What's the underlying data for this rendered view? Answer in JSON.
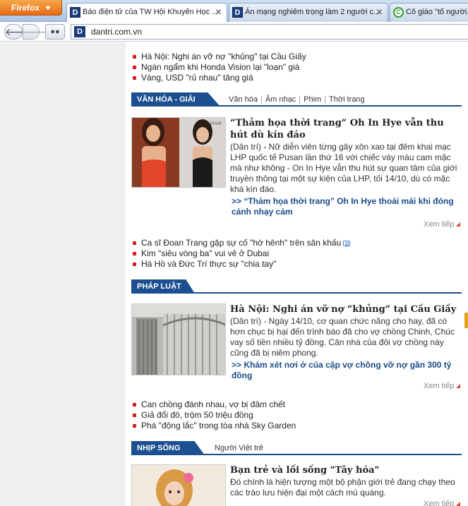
{
  "browser": {
    "menu_label": "Firefox",
    "tabs": [
      {
        "title": "Báo điện tử của TW Hội Khuyến Học ...",
        "favicon": "D",
        "active": true
      },
      {
        "title": "Án mạng nghiêm trọng làm 2 người c...",
        "favicon": "D",
        "active": false
      },
      {
        "title": "Cô giáo \"tố người...",
        "favicon": "C",
        "active": false
      }
    ],
    "url": "dantri.com.vn",
    "url_favicon": "D"
  },
  "top_list": [
    {
      "text": "Hà Nội: Nghi án vỡ nợ \"khủng\" tại Cầu Giấy"
    },
    {
      "text": "Ngán ngẩm khi Honda Vision lại \"loạn\" giá"
    },
    {
      "text": "Vàng, USD \"rủ nhau\" tăng giá"
    }
  ],
  "sections": [
    {
      "title": "VĂN HÓA - GIẢI TRÍ",
      "sub_links": [
        "Văn hóa",
        "Âm nhạc",
        "Phim",
        "Thời trang"
      ],
      "headline": "“Thảm họa thời trang” Oh In Hye vẫn thu hút dù kín đáo",
      "lead": "(Dân trí) - Nữ diễn viên từng gây xôn xao tại đêm khai mạc LHP quốc tế Pusan lần thứ 16 với chiếc váy màu cam mặc mà như không - On In Hye vẫn thu hút sự quan tâm của giới truyền thông tại một sự kiện của LHP, tối 14/10, dù có mặc khá kín đáo.",
      "related": ">> “Thảm họa thời trang” Oh In Hye thoải mái khi đóng cảnh nhạy cảm",
      "more": "Xem tiếp",
      "list": [
        {
          "text": "Ca sĩ Đoan Trang gặp sự cố \"hớ hênh\" trên sân khấu",
          "camera": true
        },
        {
          "text": "Kim \"siêu vòng ba\" vui vẻ ở Dubai",
          "camera": false
        },
        {
          "text": "Hà Hồ và Đức Trí thực sự \"chia tay\"",
          "camera": false
        }
      ]
    },
    {
      "title": "PHÁP LUẬT",
      "sub_links": [],
      "headline": "Hà Nội: Nghi án vỡ nợ “khủng” tại Cầu Giấy",
      "lead": "(Dân trí) - Ngày 14/10, cơ quan chức năng cho hay, đã có hơn chục bị hại đến trình báo đã cho vợ chồng Chinh, Chúc vay số tiền nhiều tỷ đồng. Căn nhà của đôi vợ chồng này cũng đã bị niêm phong.",
      "related": ">> Khám xét nơi ở của cặp vợ chồng vỡ nợ gần 300 tỷ đồng",
      "more": "Xem tiếp",
      "list": [
        {
          "text": "Can chồng đánh nhau, vợ bị đâm chết"
        },
        {
          "text": "Giả đổi đô, trộm 50 triệu đồng"
        },
        {
          "text": "Phá \"động lắc\" trong tòa nhà Sky Garden"
        }
      ]
    },
    {
      "title": "NHỊP SỐNG TRẺ",
      "sub_links": [
        "Người Việt trẻ"
      ],
      "headline": "Bạn trẻ và lối sống \"Tây hóa\"",
      "lead": "Đó chính là hiện tượng một bộ phận giới trẻ đang chạy theo các trào lưu hiện đại một cách mù quáng.",
      "more": "Xem tiếp"
    }
  ],
  "colors": {
    "section_blue": "#1b4f8f",
    "bullet_red": "#d21f1f",
    "link_blue": "#1a4c8a",
    "firefox_orange": "#e46a12"
  }
}
